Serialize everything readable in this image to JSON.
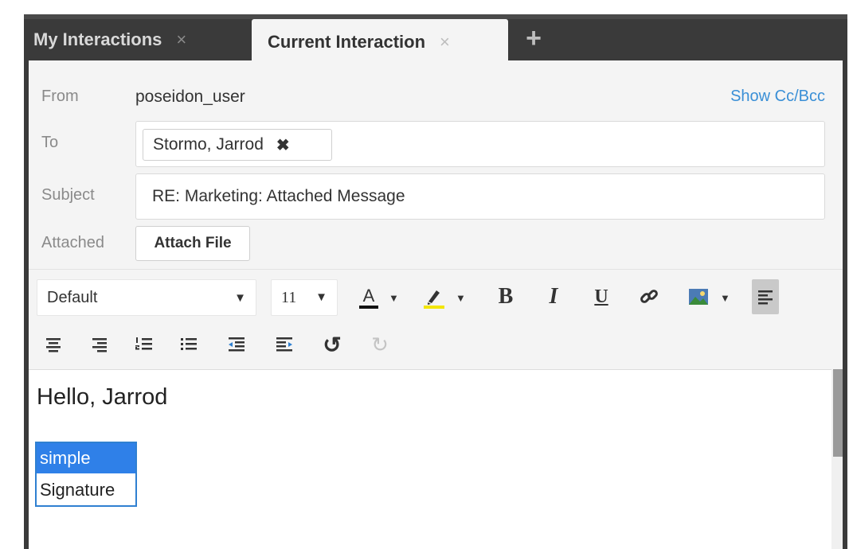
{
  "tabs": [
    {
      "label": "My Interactions",
      "close": "×"
    },
    {
      "label": "Current Interaction",
      "close": "×"
    }
  ],
  "tab_add": "+",
  "compose": {
    "from_label": "From",
    "from_value": "poseidon_user",
    "show_cc_bcc": "Show Cc/Bcc",
    "to_label": "To",
    "to_recipients": [
      {
        "name": "Stormo, Jarrod",
        "remove": "✖"
      }
    ],
    "subject_label": "Subject",
    "subject_value": "RE: Marketing: Attached Message",
    "attached_label": "Attached",
    "attach_button": "Attach File"
  },
  "toolbar": {
    "font_family": "Default",
    "font_size": "11",
    "dropdown_arrow": "▼",
    "caret": "▼",
    "bold": "B",
    "italic": "I",
    "underline": "U",
    "undo": "↺",
    "redo": "↻"
  },
  "editor": {
    "greeting": "Hello, Jarrod",
    "signature_line1": "simple",
    "signature_line2": "Signature"
  },
  "colors": {
    "accent_link": "#3a8fd6",
    "selection": "#2f80e8",
    "tab_bar": "#3a3a3a",
    "panel": "#f4f4f4"
  }
}
